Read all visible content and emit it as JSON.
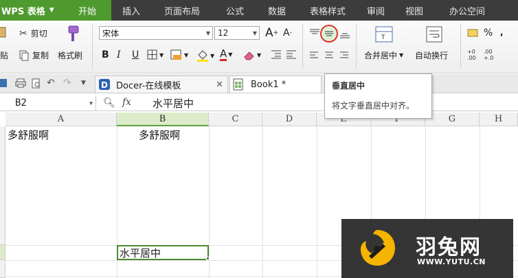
{
  "menubar": {
    "app_name": "WPS 表格",
    "tabs": [
      "开始",
      "插入",
      "页面布局",
      "公式",
      "数据",
      "表格样式",
      "审阅",
      "视图",
      "办公空间"
    ],
    "active_tab": "开始",
    "accent_color": "#4e9a2e"
  },
  "ribbon": {
    "clipboard": {
      "cut": "剪切",
      "paste_partial": "贴",
      "copy": "复制",
      "format_painter": "格式刷"
    },
    "font": {
      "name": "宋体",
      "size": "12",
      "bold": "B",
      "italic": "I",
      "underline": "U",
      "grow": "A",
      "shrink": "A"
    },
    "align": {
      "merge_center": "合并居中",
      "wrap_text": "自动换行"
    },
    "number": {
      "percent": "%"
    }
  },
  "doc_tabs": [
    {
      "label": "Docer-在线模板",
      "closable": true
    },
    {
      "label": "Book1 *",
      "closable": false
    }
  ],
  "formula_bar": {
    "cell_ref": "B2",
    "fx_label": "fx",
    "value": "水平居中"
  },
  "columns": [
    "A",
    "B",
    "C",
    "D",
    "E",
    "F",
    "G",
    "H"
  ],
  "selected_column": "B",
  "cells": {
    "a_row1": "多舒服啊",
    "b_row1": "多舒服啊",
    "active": "水平居中"
  },
  "tooltip": {
    "title": "垂直居中",
    "body": "将文字垂直居中对齐。"
  },
  "watermark": {
    "cn": "羽兔网",
    "en": "WWW.YUTU.CN",
    "logo_color": "#f5b400"
  }
}
